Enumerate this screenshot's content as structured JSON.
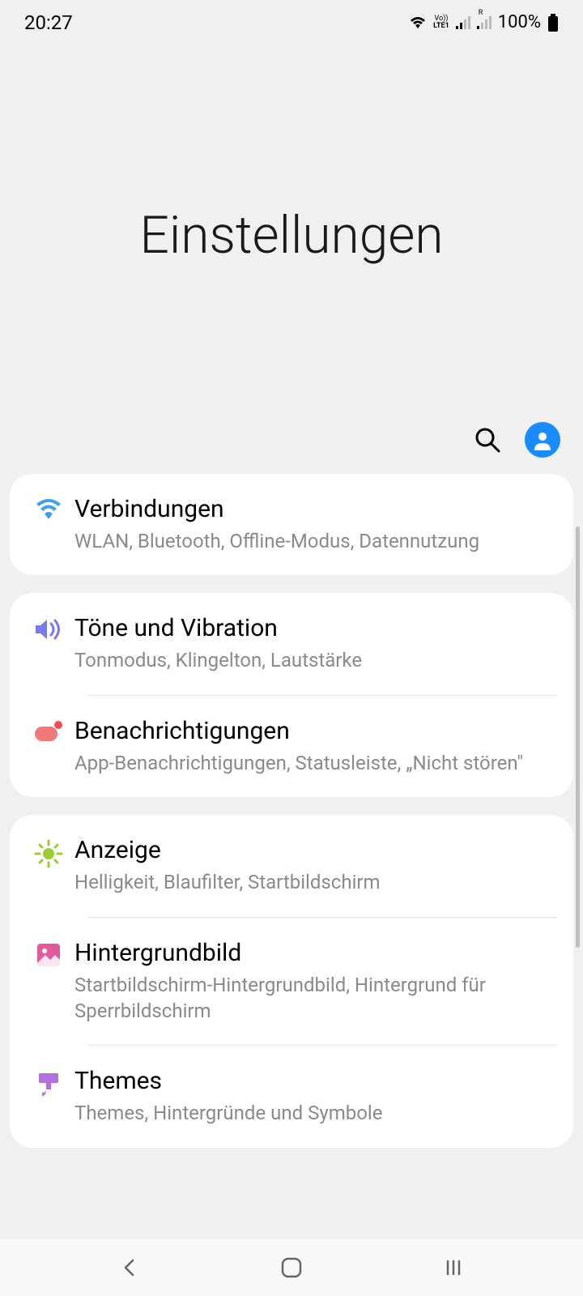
{
  "status": {
    "time": "20:27",
    "battery": "100%",
    "lte_label": "LTE1",
    "vo_label": "Vo))",
    "roam_label": "R"
  },
  "hero": {
    "title": "Einstellungen"
  },
  "groups": [
    {
      "items": [
        {
          "id": "connections",
          "title": "Verbindungen",
          "sub": "WLAN, Bluetooth, Offline-Modus, Datennutzung",
          "icon": "wifi",
          "color": "#3ea0f0"
        }
      ]
    },
    {
      "items": [
        {
          "id": "sounds",
          "title": "Töne und Vibration",
          "sub": "Tonmodus, Klingelton, Lautstärke",
          "icon": "volume",
          "color": "#7a7af0"
        },
        {
          "id": "notifications",
          "title": "Benachrichtigungen",
          "sub": "App-Benachrichtigungen, Statusleiste, „Nicht stören\"",
          "icon": "notif",
          "color": "#f07a7a"
        }
      ]
    },
    {
      "items": [
        {
          "id": "display",
          "title": "Anzeige",
          "sub": "Helligkeit, Blaufilter, Startbildschirm",
          "icon": "sun",
          "color": "#9acd32"
        },
        {
          "id": "wallpaper",
          "title": "Hintergrundbild",
          "sub": "Startbildschirm-Hintergrundbild, Hintergrund für Sperrbildschirm",
          "icon": "image",
          "color": "#e05a9c"
        },
        {
          "id": "themes",
          "title": "Themes",
          "sub": "Themes, Hintergründe und Symbole",
          "icon": "brush",
          "color": "#b070e0"
        }
      ]
    }
  ]
}
